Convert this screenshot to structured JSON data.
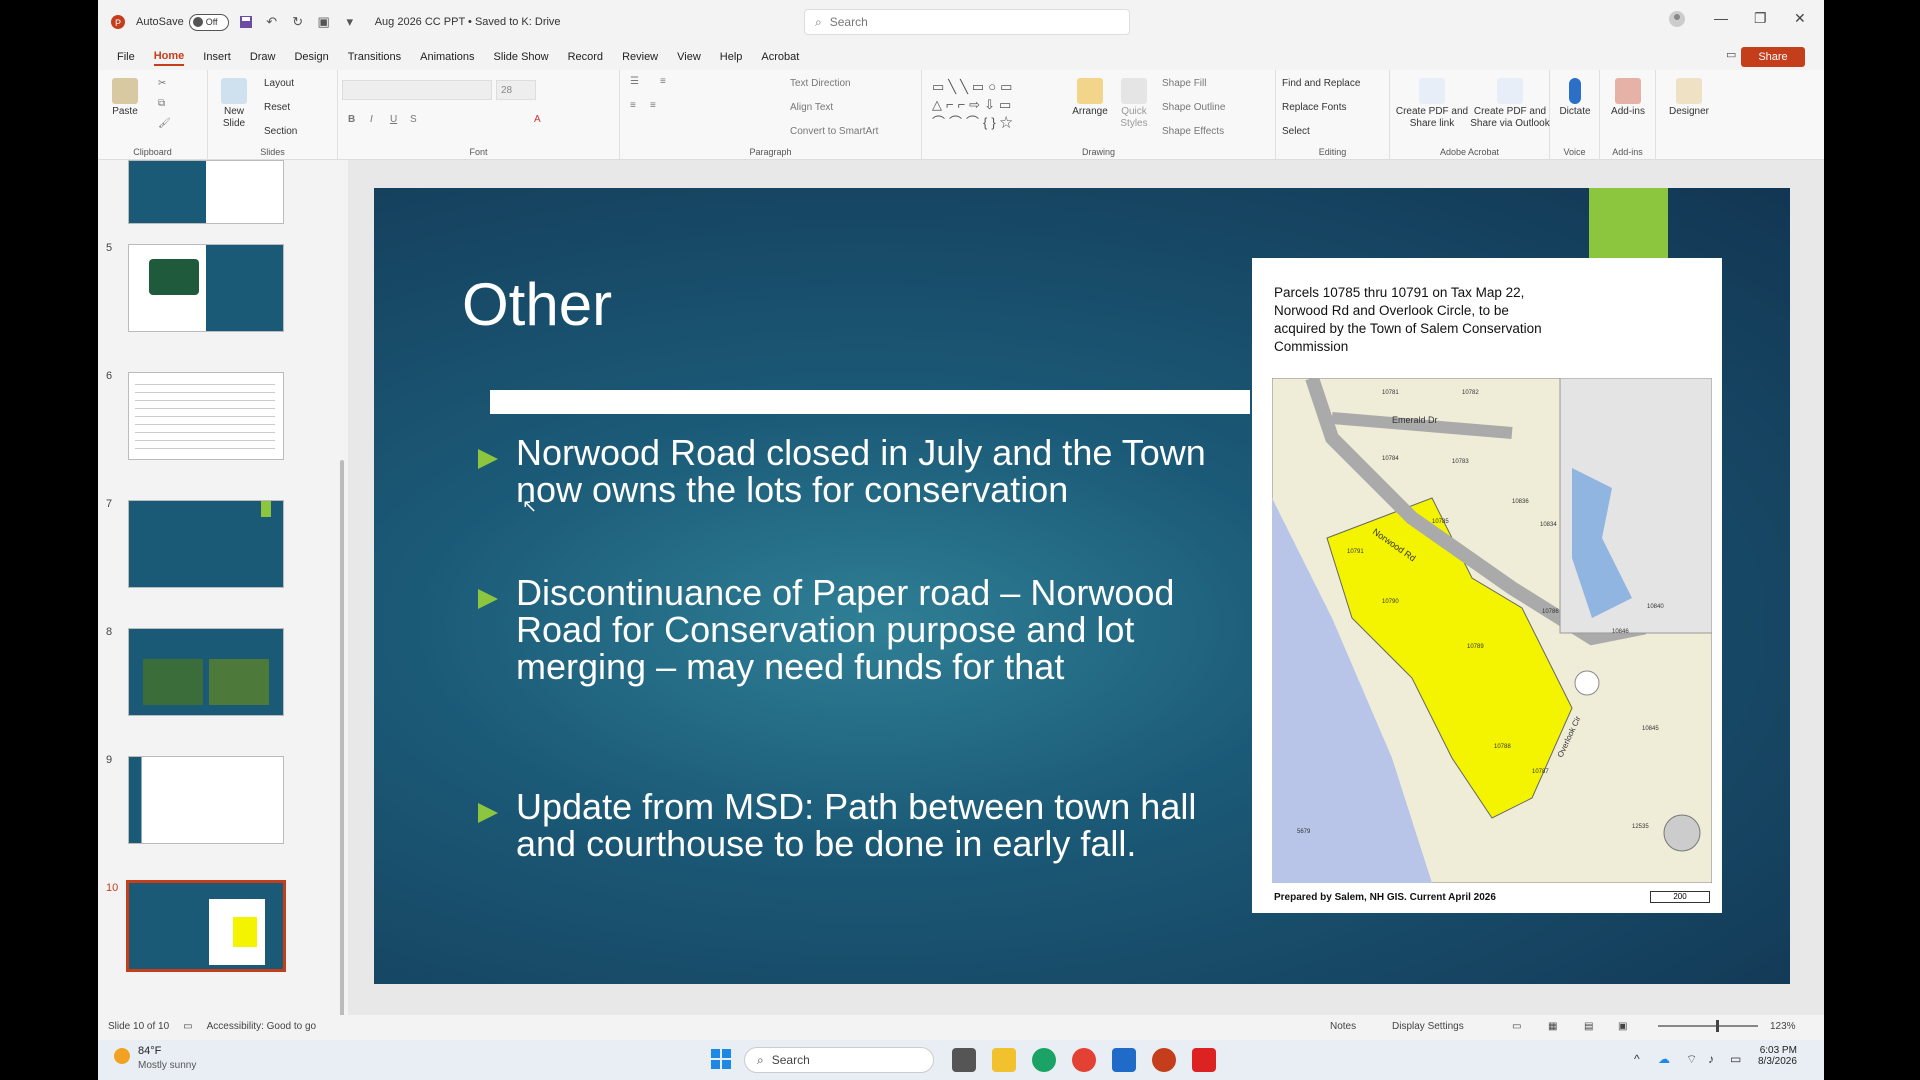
{
  "titlebar": {
    "autosave_label": "AutoSave",
    "autosave_state": "Off",
    "document_title": "Aug 2026 CC PPT • Saved to K: Drive",
    "search_placeholder": "Search"
  },
  "menu": [
    "File",
    "Home",
    "Insert",
    "Draw",
    "Design",
    "Transitions",
    "Animations",
    "Slide Show",
    "Record",
    "Review",
    "View",
    "Help",
    "Acrobat"
  ],
  "share_label": "Share",
  "ribbon": {
    "clipboard": {
      "paste": "Paste",
      "label": "Clipboard"
    },
    "slides": {
      "new_slide": "New Slide",
      "layout": "Layout",
      "reset": "Reset",
      "section": "Section",
      "label": "Slides"
    },
    "font": {
      "size": "28",
      "label": "Font"
    },
    "paragraph": {
      "text_direction": "Text Direction",
      "align_text": "Align Text",
      "convert": "Convert to SmartArt",
      "label": "Paragraph"
    },
    "drawing": {
      "arrange": "Arrange",
      "quick_styles": "Quick Styles",
      "shape_fill": "Shape Fill",
      "shape_outline": "Shape Outline",
      "shape_effects": "Shape Effects",
      "label": "Drawing"
    },
    "editing": {
      "find": "Find and Replace",
      "replace_fonts": "Replace Fonts",
      "select": "Select",
      "label": "Editing"
    },
    "acrobat": {
      "create_pdf_link": "Create PDF and Share link",
      "create_pdf_outlook": "Create PDF and Share via Outlook",
      "label": "Adobe Acrobat"
    },
    "voice": {
      "dictate": "Dictate",
      "label": "Voice"
    },
    "addins": {
      "addins": "Add-ins",
      "label": "Add-ins"
    },
    "designer": "Designer"
  },
  "thumbnails": [
    {
      "num": "5"
    },
    {
      "num": "6"
    },
    {
      "num": "7"
    },
    {
      "num": "8"
    },
    {
      "num": "9"
    },
    {
      "num": "10"
    }
  ],
  "slide": {
    "title": "Other",
    "bullets": [
      "Norwood Road closed in July and the Town now owns the lots for conservation",
      "Discontinuance of Paper road – Norwood Road for Conservation purpose and lot merging – may need funds for that",
      "Update from MSD: Path between town hall and courthouse to be done in early fall."
    ],
    "map": {
      "title": "Parcels 10785 thru 10791 on Tax Map 22, Norwood Rd and Overlook Circle, to be acquired by the Town of Salem Conservation Commission",
      "footer": "Prepared by Salem, NH GIS. Current April 2026",
      "streets": [
        "Emerald Dr",
        "Norwood Rd",
        "Overlook Cir"
      ],
      "parcels": [
        "10781",
        "10782",
        "10783",
        "10784",
        "10785",
        "10786",
        "10787",
        "10788",
        "10789",
        "10790",
        "10791",
        "10836",
        "10834",
        "10840",
        "10845",
        "10846",
        "12535",
        "5679"
      ],
      "scale": "200",
      "colors": {
        "acquired": "#f4f400",
        "water": "#b8c4e8",
        "parcel": "#efedd8"
      }
    }
  },
  "status": {
    "slide_of": "Slide 10 of 10",
    "accessibility": "Accessibility: Good to go",
    "notes": "Notes",
    "display": "Display Settings",
    "zoom": "123%"
  },
  "taskbar": {
    "weather_temp": "84°F",
    "weather_desc": "Mostly sunny",
    "search": "Search",
    "time": "6:03 PM",
    "date": "8/3/2026"
  }
}
